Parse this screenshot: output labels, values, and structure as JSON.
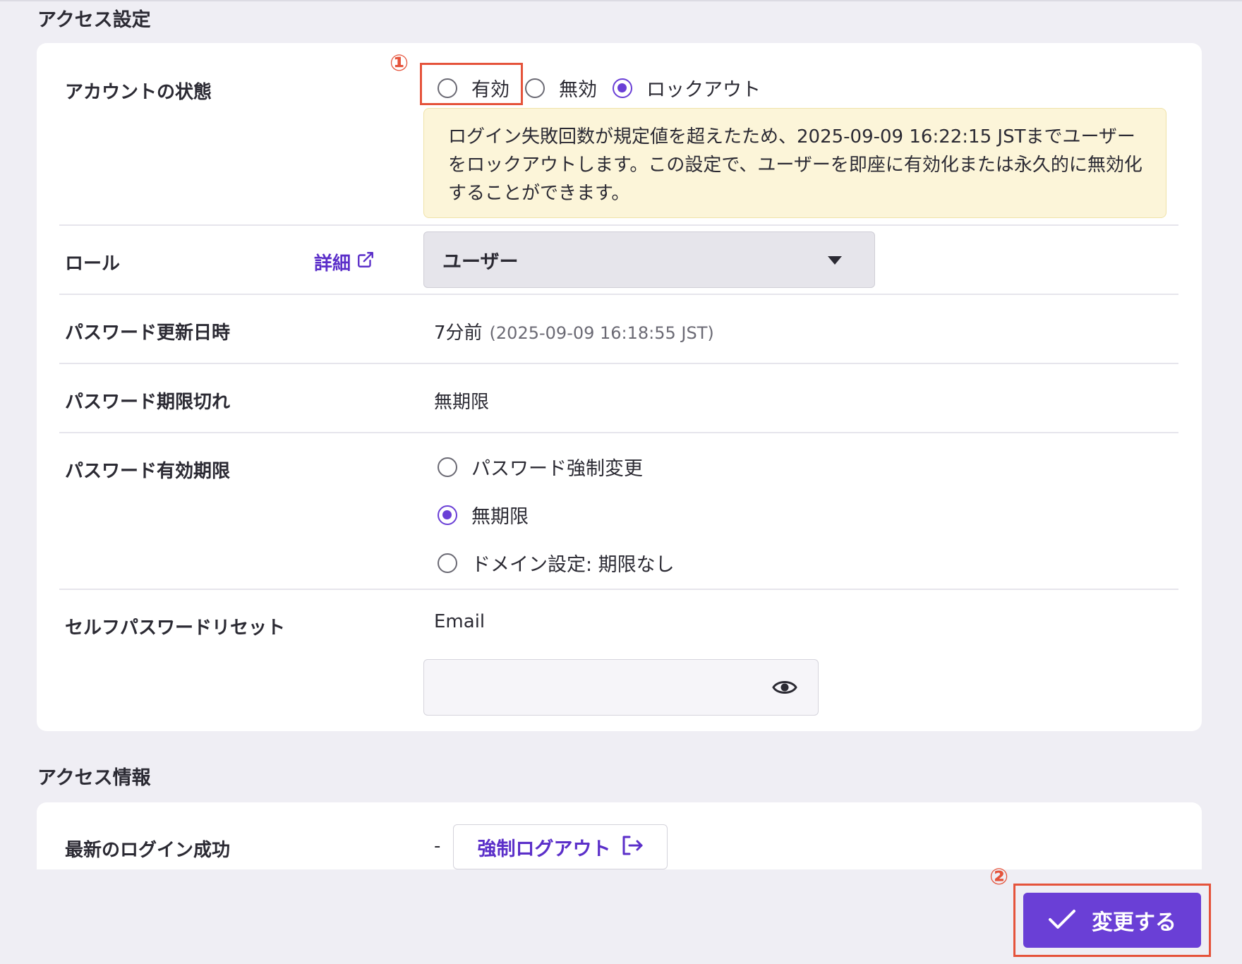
{
  "access_settings": {
    "section_title": "アクセス設定",
    "account_status": {
      "label": "アカウントの状態",
      "options": [
        {
          "label": "有効",
          "checked": false
        },
        {
          "label": "無効",
          "checked": false
        },
        {
          "label": "ロックアウト",
          "checked": true
        }
      ],
      "notice": "ログイン失敗回数が規定値を超えたため、2025-09-09 16:22:15 JSTまでユーザーをロックアウトします。この設定で、ユーザーを即座に有効化または永久的に無効化することができます。"
    },
    "role": {
      "label": "ロール",
      "detail_link": "詳細",
      "selected": "ユーザー"
    },
    "password_updated": {
      "label": "パスワード更新日時",
      "relative": "7分前",
      "absolute": "(2025-09-09 16:18:55 JST)"
    },
    "password_expiry": {
      "label": "パスワード期限切れ",
      "value": "無期限"
    },
    "password_validity": {
      "label": "パスワード有効期限",
      "options": [
        {
          "label": "パスワード強制変更",
          "checked": false
        },
        {
          "label": "無期限",
          "checked": true
        },
        {
          "label": "ドメイン設定: 期限なし",
          "checked": false
        }
      ]
    },
    "self_reset": {
      "label": "セルフパスワードリセット",
      "method": "Email",
      "input_value": ""
    }
  },
  "access_info": {
    "section_title": "アクセス情報",
    "last_login": {
      "label": "最新のログイン成功",
      "value": "-",
      "force_logout_label": "強制ログアウト"
    }
  },
  "annotations": [
    "①",
    "②"
  ],
  "submit_label": "変更する",
  "colors": {
    "accent": "#6a3fd6",
    "annotation": "#e5533b",
    "notice_bg": "#fcf5d9"
  }
}
